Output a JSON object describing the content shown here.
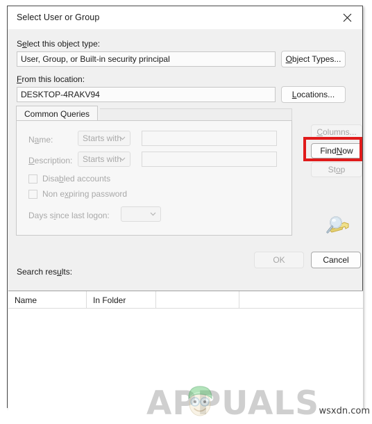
{
  "window": {
    "title": "Select User or Group",
    "close_icon": "close-icon"
  },
  "object_type": {
    "label_pre": "S",
    "label_acc": "e",
    "label_post": "lect this object type:",
    "value": "User, Group, or Built-in security principal",
    "button": {
      "pre": "",
      "acc": "O",
      "post": "bject Types..."
    }
  },
  "location": {
    "label_pre": "",
    "label_acc": "F",
    "label_post": "rom this location:",
    "value": "DESKTOP-4RAKV94",
    "button": {
      "pre": "",
      "acc": "L",
      "post": "ocations..."
    }
  },
  "tab": {
    "label": "Common Queries"
  },
  "query": {
    "name": {
      "label_pre": "N",
      "label_acc": "a",
      "label_post": "me:",
      "operator": "Starts with",
      "value": "",
      "placeholder": ""
    },
    "description": {
      "label_pre": "",
      "label_acc": "D",
      "label_post": "escription:",
      "operator": "Starts with",
      "value": "",
      "placeholder": ""
    },
    "disabled_accounts": {
      "pre": "Disa",
      "acc": "b",
      "post": "led accounts",
      "checked": false
    },
    "non_expiring_password": {
      "pre": "Non e",
      "acc": "x",
      "post": "piring password",
      "checked": false
    },
    "days_since_logon": {
      "label_pre": "Days s",
      "label_acc": "i",
      "label_post": "nce last logon:",
      "value": ""
    }
  },
  "side_buttons": {
    "columns": {
      "pre": "",
      "acc": "C",
      "post": "olumns...",
      "enabled": false
    },
    "find_now": {
      "pre": "Find ",
      "acc": "N",
      "post": "ow",
      "enabled": true
    },
    "stop": {
      "pre": "St",
      "acc": "o",
      "post": "p",
      "enabled": false
    }
  },
  "icons": {
    "search_key": "search-key-icon",
    "chevron": "chevron-down-icon"
  },
  "dialog_buttons": {
    "ok": {
      "label": "OK",
      "enabled": false
    },
    "cancel": {
      "label": "Cancel",
      "enabled": true
    }
  },
  "results": {
    "label_pre": "Search res",
    "label_acc": "u",
    "label_post": "lts:",
    "columns": [
      "Name",
      "In Folder",
      ""
    ],
    "rows": []
  },
  "annotation": {
    "color": "#e01b1b",
    "target": "find-now-button"
  },
  "watermark": {
    "text": "APPUALS",
    "site": "wsxdn.com"
  }
}
